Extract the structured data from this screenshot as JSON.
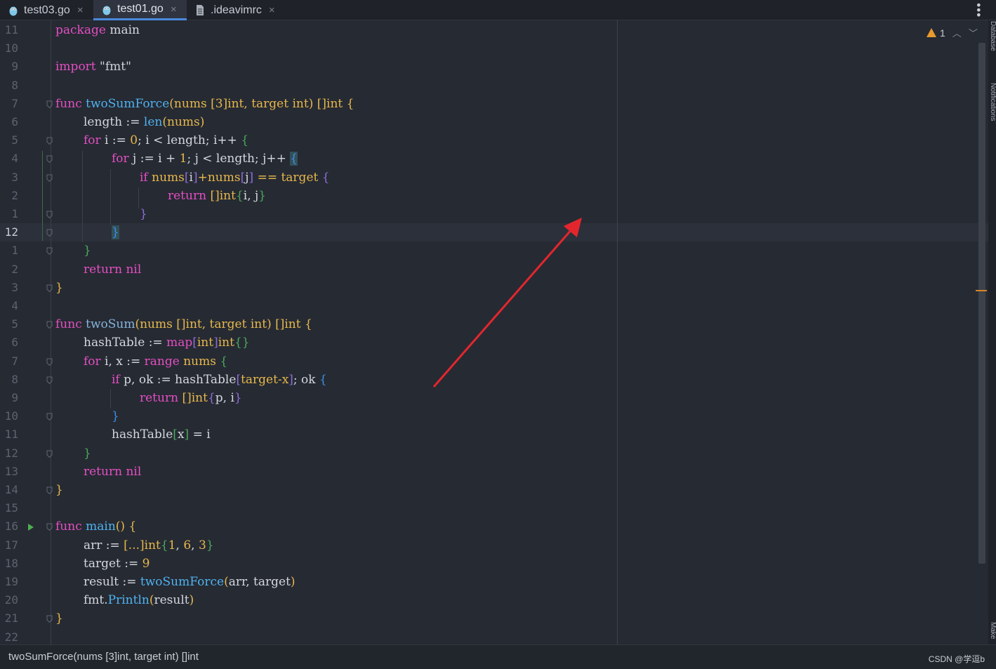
{
  "tabs": [
    {
      "label": "test03.go",
      "icon": "gopher-icon",
      "active": false
    },
    {
      "label": "test01.go",
      "icon": "gopher-icon",
      "active": true
    },
    {
      "label": ".ideavimrc",
      "icon": "file-icon",
      "active": false
    }
  ],
  "close_glyph": "×",
  "menu_glyph": "⋮",
  "inspection": {
    "warning_count": "1"
  },
  "side_panels": [
    "Database",
    "Notifications",
    "Make"
  ],
  "line_numbers": [
    "11",
    "10",
    "9",
    "8",
    "7",
    "6",
    "5",
    "4",
    "3",
    "2",
    "1",
    "12",
    "1",
    "2",
    "3",
    "4",
    "5",
    "6",
    "7",
    "8",
    "9",
    "10",
    "11",
    "12",
    "13",
    "14",
    "15",
    "16",
    "17",
    "18",
    "19",
    "20",
    "21",
    "22"
  ],
  "code": {
    "l0": [
      "package",
      " main"
    ],
    "l2": [
      "import",
      " \"fmt\""
    ],
    "l4": [
      "func",
      " ",
      "twoSumForce",
      "(",
      "nums ",
      "[3]",
      "int",
      ", target ",
      "int",
      ") ",
      "[]",
      "int",
      " {"
    ],
    "l5": [
      "length := ",
      "len",
      "(",
      "nums",
      ")"
    ],
    "l6": [
      "for",
      " i := ",
      "0",
      "; i < length; i++ ",
      "{"
    ],
    "l7": [
      "for",
      " j := i + ",
      "1",
      "; j < length; j++ ",
      "{"
    ],
    "l8": [
      "if",
      " nums",
      "[",
      "i",
      "]",
      "+nums",
      "[",
      "j",
      "]",
      " == target ",
      "{"
    ],
    "l9": [
      "return",
      " ",
      "[]",
      "int",
      "{",
      "i, j",
      "}"
    ],
    "l10": [
      "}"
    ],
    "l11": [
      "}"
    ],
    "l12": [
      "}"
    ],
    "l13": [
      "return",
      " ",
      "nil"
    ],
    "l14": [
      "}"
    ],
    "l16": [
      "func",
      " ",
      "twoSum",
      "(",
      "nums ",
      "[]",
      "int",
      ", target ",
      "int",
      ") ",
      "[]",
      "int",
      " {"
    ],
    "l17": [
      "hashTable := ",
      "map",
      "[",
      "int",
      "]",
      "int",
      "{}"
    ],
    "l18": [
      "for",
      " i, x := ",
      "range",
      " nums ",
      "{"
    ],
    "l19": [
      "if",
      " p, ok := hashTable",
      "[",
      "target-x",
      "]",
      "; ok ",
      "{"
    ],
    "l20": [
      "return",
      " ",
      "[]",
      "int",
      "{",
      "p, i",
      "}"
    ],
    "l21": [
      "}"
    ],
    "l22": [
      "hashTable",
      "[",
      "x",
      "]",
      " = i"
    ],
    "l23": [
      "}"
    ],
    "l24": [
      "return",
      " ",
      "nil"
    ],
    "l25": [
      "}"
    ],
    "l27": [
      "func",
      " ",
      "main",
      "() ",
      "{"
    ],
    "l28": [
      "arr := ",
      "[...]",
      "int",
      "{",
      "1",
      ", ",
      "6",
      ", ",
      "3",
      "}"
    ],
    "l29": [
      "target := ",
      "9"
    ],
    "l30": [
      "result := ",
      "twoSumForce",
      "(",
      "arr, target",
      ")"
    ],
    "l31": [
      "fmt.",
      "Println",
      "(",
      "result",
      ")"
    ],
    "l32": [
      "}"
    ]
  },
  "status": {
    "hint": "twoSumForce(nums [3]int, target int) []int",
    "watermark": "CSDN @学逗b"
  },
  "colors": {
    "active_tab_underline": "#4a89dc",
    "warning": "#e89a2c",
    "arrow": "#e3262d"
  }
}
